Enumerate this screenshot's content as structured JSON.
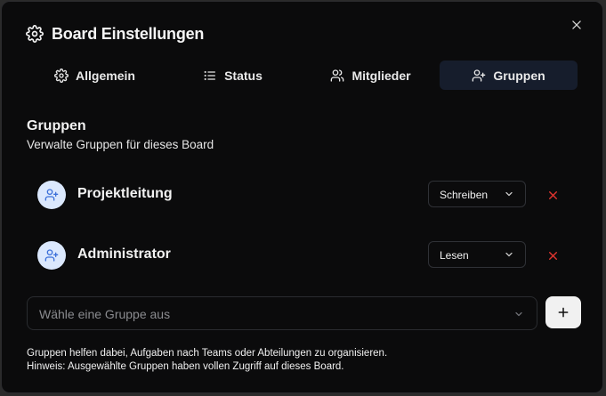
{
  "dialog": {
    "title": "Board Einstellungen",
    "header_icon": "gear-icon",
    "close_icon": "close-icon"
  },
  "tabs": [
    {
      "label": "Allgemein",
      "icon": "gear-icon",
      "active": false
    },
    {
      "label": "Status",
      "icon": "list-icon",
      "active": false
    },
    {
      "label": "Mitglieder",
      "icon": "users-icon",
      "active": false
    },
    {
      "label": "Gruppen",
      "icon": "user-plus-icon",
      "active": true
    }
  ],
  "section": {
    "title": "Gruppen",
    "subtitle": "Verwalte Gruppen für dieses Board"
  },
  "groups": [
    {
      "name": "Projektleitung",
      "permission": "Schreiben"
    },
    {
      "name": "Administrator",
      "permission": "Lesen"
    }
  ],
  "add_group": {
    "placeholder": "Wähle eine Gruppe aus",
    "add_button_icon": "plus-icon"
  },
  "footnote": {
    "line1": "Gruppen helfen dabei, Aufgaben nach Teams oder Abteilungen zu organisieren.",
    "line2": "Hinweis: Ausgewählte Gruppen haben vollen Zugriff auf dieses Board."
  },
  "colors": {
    "background": "#0b0b0c",
    "active_tab": "#161d2c",
    "avatar_bg": "#dbe8fd",
    "avatar_icon": "#3b6fd9",
    "remove_icon": "#e0342f"
  }
}
